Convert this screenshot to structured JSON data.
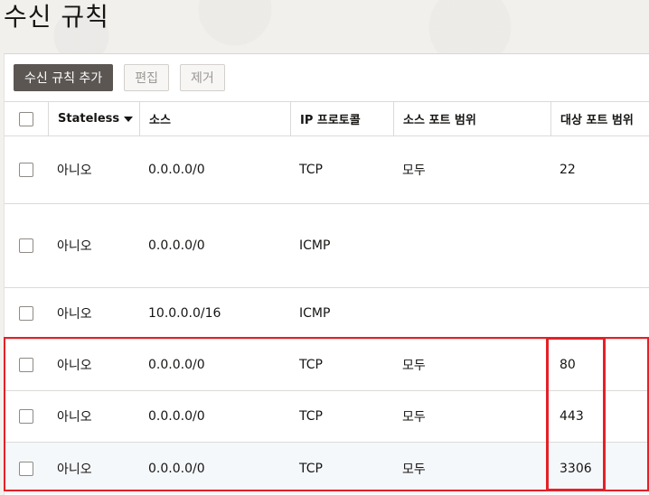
{
  "page": {
    "title": "수신 규칙"
  },
  "toolbar": {
    "add_label": "수신 규칙 추가",
    "edit_label": "편집",
    "remove_label": "제거"
  },
  "table": {
    "columns": {
      "stateless": "Stateless",
      "source": "소스",
      "protocol": "IP 프로토콜",
      "source_port": "소스 포트 범위",
      "dest_port": "대상 포트 범위"
    },
    "sort_column": "Stateless",
    "sort_direction": "descending",
    "rows": [
      {
        "stateless": "아니오",
        "source": "0.0.0.0/0",
        "protocol": "TCP",
        "source_port": "모두",
        "dest_port": "22"
      },
      {
        "stateless": "아니오",
        "source": "0.0.0.0/0",
        "protocol": "ICMP",
        "source_port": "",
        "dest_port": ""
      },
      {
        "stateless": "아니오",
        "source": "10.0.0.0/16",
        "protocol": "ICMP",
        "source_port": "",
        "dest_port": ""
      },
      {
        "stateless": "아니오",
        "source": "0.0.0.0/0",
        "protocol": "TCP",
        "source_port": "모두",
        "dest_port": "80"
      },
      {
        "stateless": "아니오",
        "source": "0.0.0.0/0",
        "protocol": "TCP",
        "source_port": "모두",
        "dest_port": "443"
      },
      {
        "stateless": "아니오",
        "source": "0.0.0.0/0",
        "protocol": "TCP",
        "source_port": "모두",
        "dest_port": "3306"
      }
    ]
  },
  "annotation": {
    "highlight_color": "#e32128"
  }
}
